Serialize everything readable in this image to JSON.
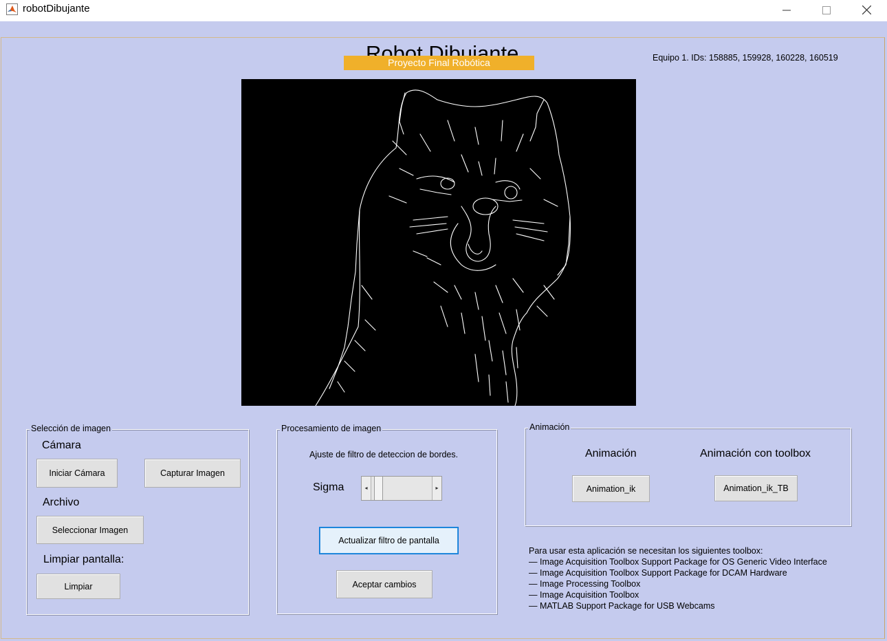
{
  "window": {
    "title": "robotDibujante",
    "minimize": "—",
    "maximize": "☐",
    "close": "✕"
  },
  "header": {
    "title": "Robot Dibujante",
    "subtitle": "Proyecto Final Robótica",
    "team_ids": "Equipo 1. IDs: 158885, 159928, 160228, 160519"
  },
  "colors": {
    "background": "#c5cbee",
    "accent": "#f0b02a",
    "panel_border": "#d4b98a"
  },
  "image_view": {
    "content": "edge-detected cat image (white edges on black)"
  },
  "seleccion": {
    "title": "Selección de imagen",
    "camara_label": "Cámara",
    "iniciar_camara": "Iniciar Cámara",
    "capturar_imagen": "Capturar Imagen",
    "archivo_label": "Archivo",
    "seleccionar_imagen": "Seleccionar Imagen",
    "limpiar_label": "Limpiar pantalla:",
    "limpiar": "Limpiar"
  },
  "procesamiento": {
    "title": "Procesamiento de imagen",
    "ajuste_label": "Ajuste de filtro de deteccion de bordes.",
    "sigma_label": "Sigma",
    "sigma_slider_fraction": 0.05,
    "actualizar": "Actualizar filtro de pantalla",
    "aceptar": "Aceptar cambios"
  },
  "animacion": {
    "title": "Animación",
    "animacion_label": "Animación",
    "toolbox_label": "Animación con toolbox",
    "animation_ik": "Animation_ik",
    "animation_ik_tb": "Animation_ik_TB"
  },
  "info": {
    "intro": "Para usar esta aplicación se necesitan los siguientes toolbox:",
    "items": [
      "— Image Acquisition Toolbox Support Package for OS Generic Video Interface",
      "— Image Acquisition Toolbox Support Package for DCAM Hardware",
      "— Image Processing Toolbox",
      "— Image Acquisition Toolbox",
      "— MATLAB Support Package for USB Webcams"
    ]
  },
  "icons": {
    "app": "matlab-icon",
    "slider_left": "arrow-left-icon",
    "slider_right": "arrow-right-icon"
  }
}
